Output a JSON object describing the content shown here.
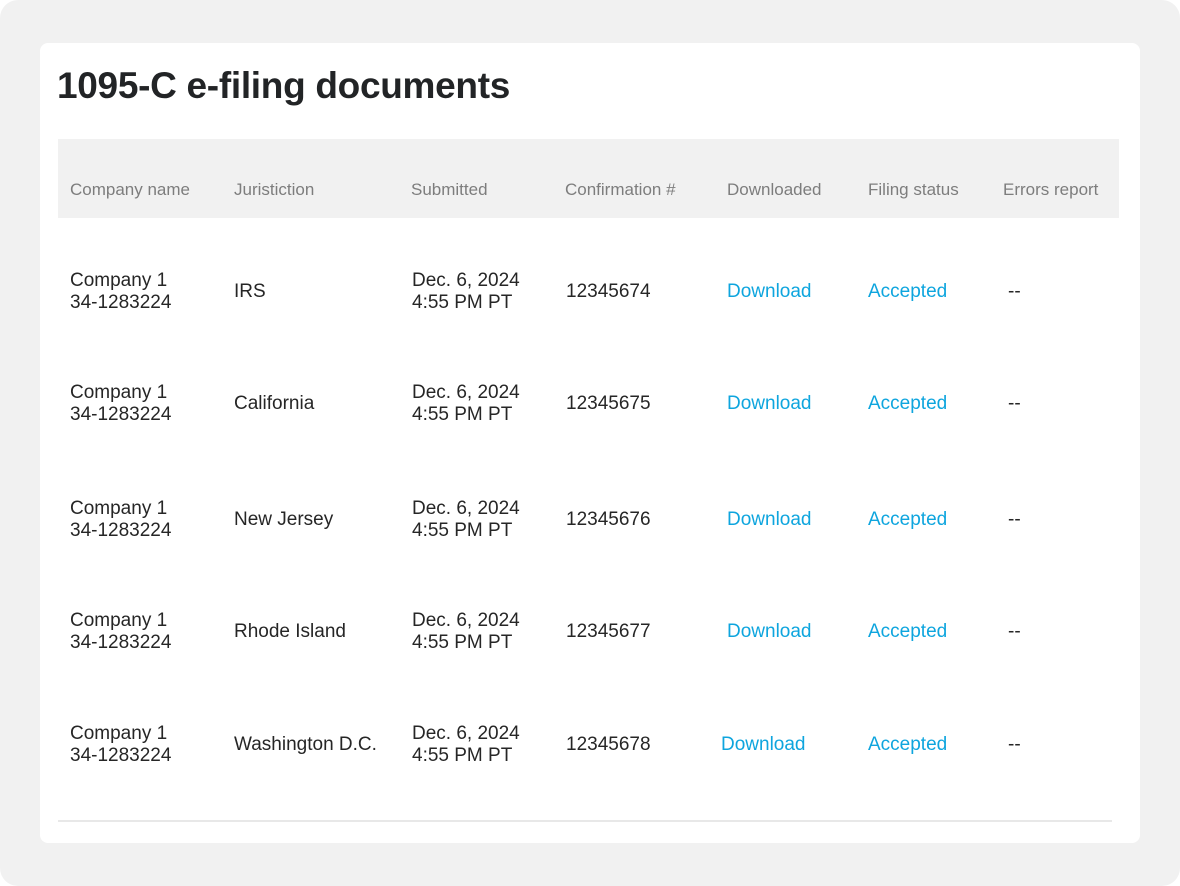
{
  "page": {
    "title": "1095-C e-filing documents"
  },
  "table": {
    "columns": [
      "Company name",
      "Juristiction",
      "Submitted",
      "Confirmation #",
      "Downloaded",
      "Filing status",
      "Errors report"
    ],
    "rows": [
      {
        "company": "Company 1",
        "ein": "34-1283224",
        "jurisdiction": "IRS",
        "submitted_date": "Dec. 6, 2024",
        "submitted_time": "4:55 PM PT",
        "confirmation": "12345674",
        "downloaded": "Download",
        "status": "Accepted",
        "errors": "--"
      },
      {
        "company": "Company 1",
        "ein": "34-1283224",
        "jurisdiction": "California",
        "submitted_date": "Dec. 6, 2024",
        "submitted_time": "4:55 PM PT",
        "confirmation": "12345675",
        "downloaded": "Download",
        "status": "Accepted",
        "errors": "--"
      },
      {
        "company": "Company 1",
        "ein": "34-1283224",
        "jurisdiction": "New Jersey",
        "submitted_date": "Dec. 6, 2024",
        "submitted_time": "4:55 PM PT",
        "confirmation": "12345676",
        "downloaded": "Download",
        "status": "Accepted",
        "errors": "--"
      },
      {
        "company": "Company 1",
        "ein": "34-1283224",
        "jurisdiction": "Rhode Island",
        "submitted_date": "Dec. 6, 2024",
        "submitted_time": "4:55 PM PT",
        "confirmation": "12345677",
        "downloaded": "Download",
        "status": "Accepted",
        "errors": "--"
      },
      {
        "company": "Company 1",
        "ein": "34-1283224",
        "jurisdiction": "Washington D.C.",
        "submitted_date": "Dec. 6, 2024",
        "submitted_time": "4:55 PM PT",
        "confirmation": "12345678",
        "downloaded": "Download",
        "status": "Accepted",
        "errors": "--"
      }
    ]
  },
  "colors": {
    "link": "#0ea5de",
    "header_bg": "#f1f1f1",
    "title": "#222426"
  }
}
